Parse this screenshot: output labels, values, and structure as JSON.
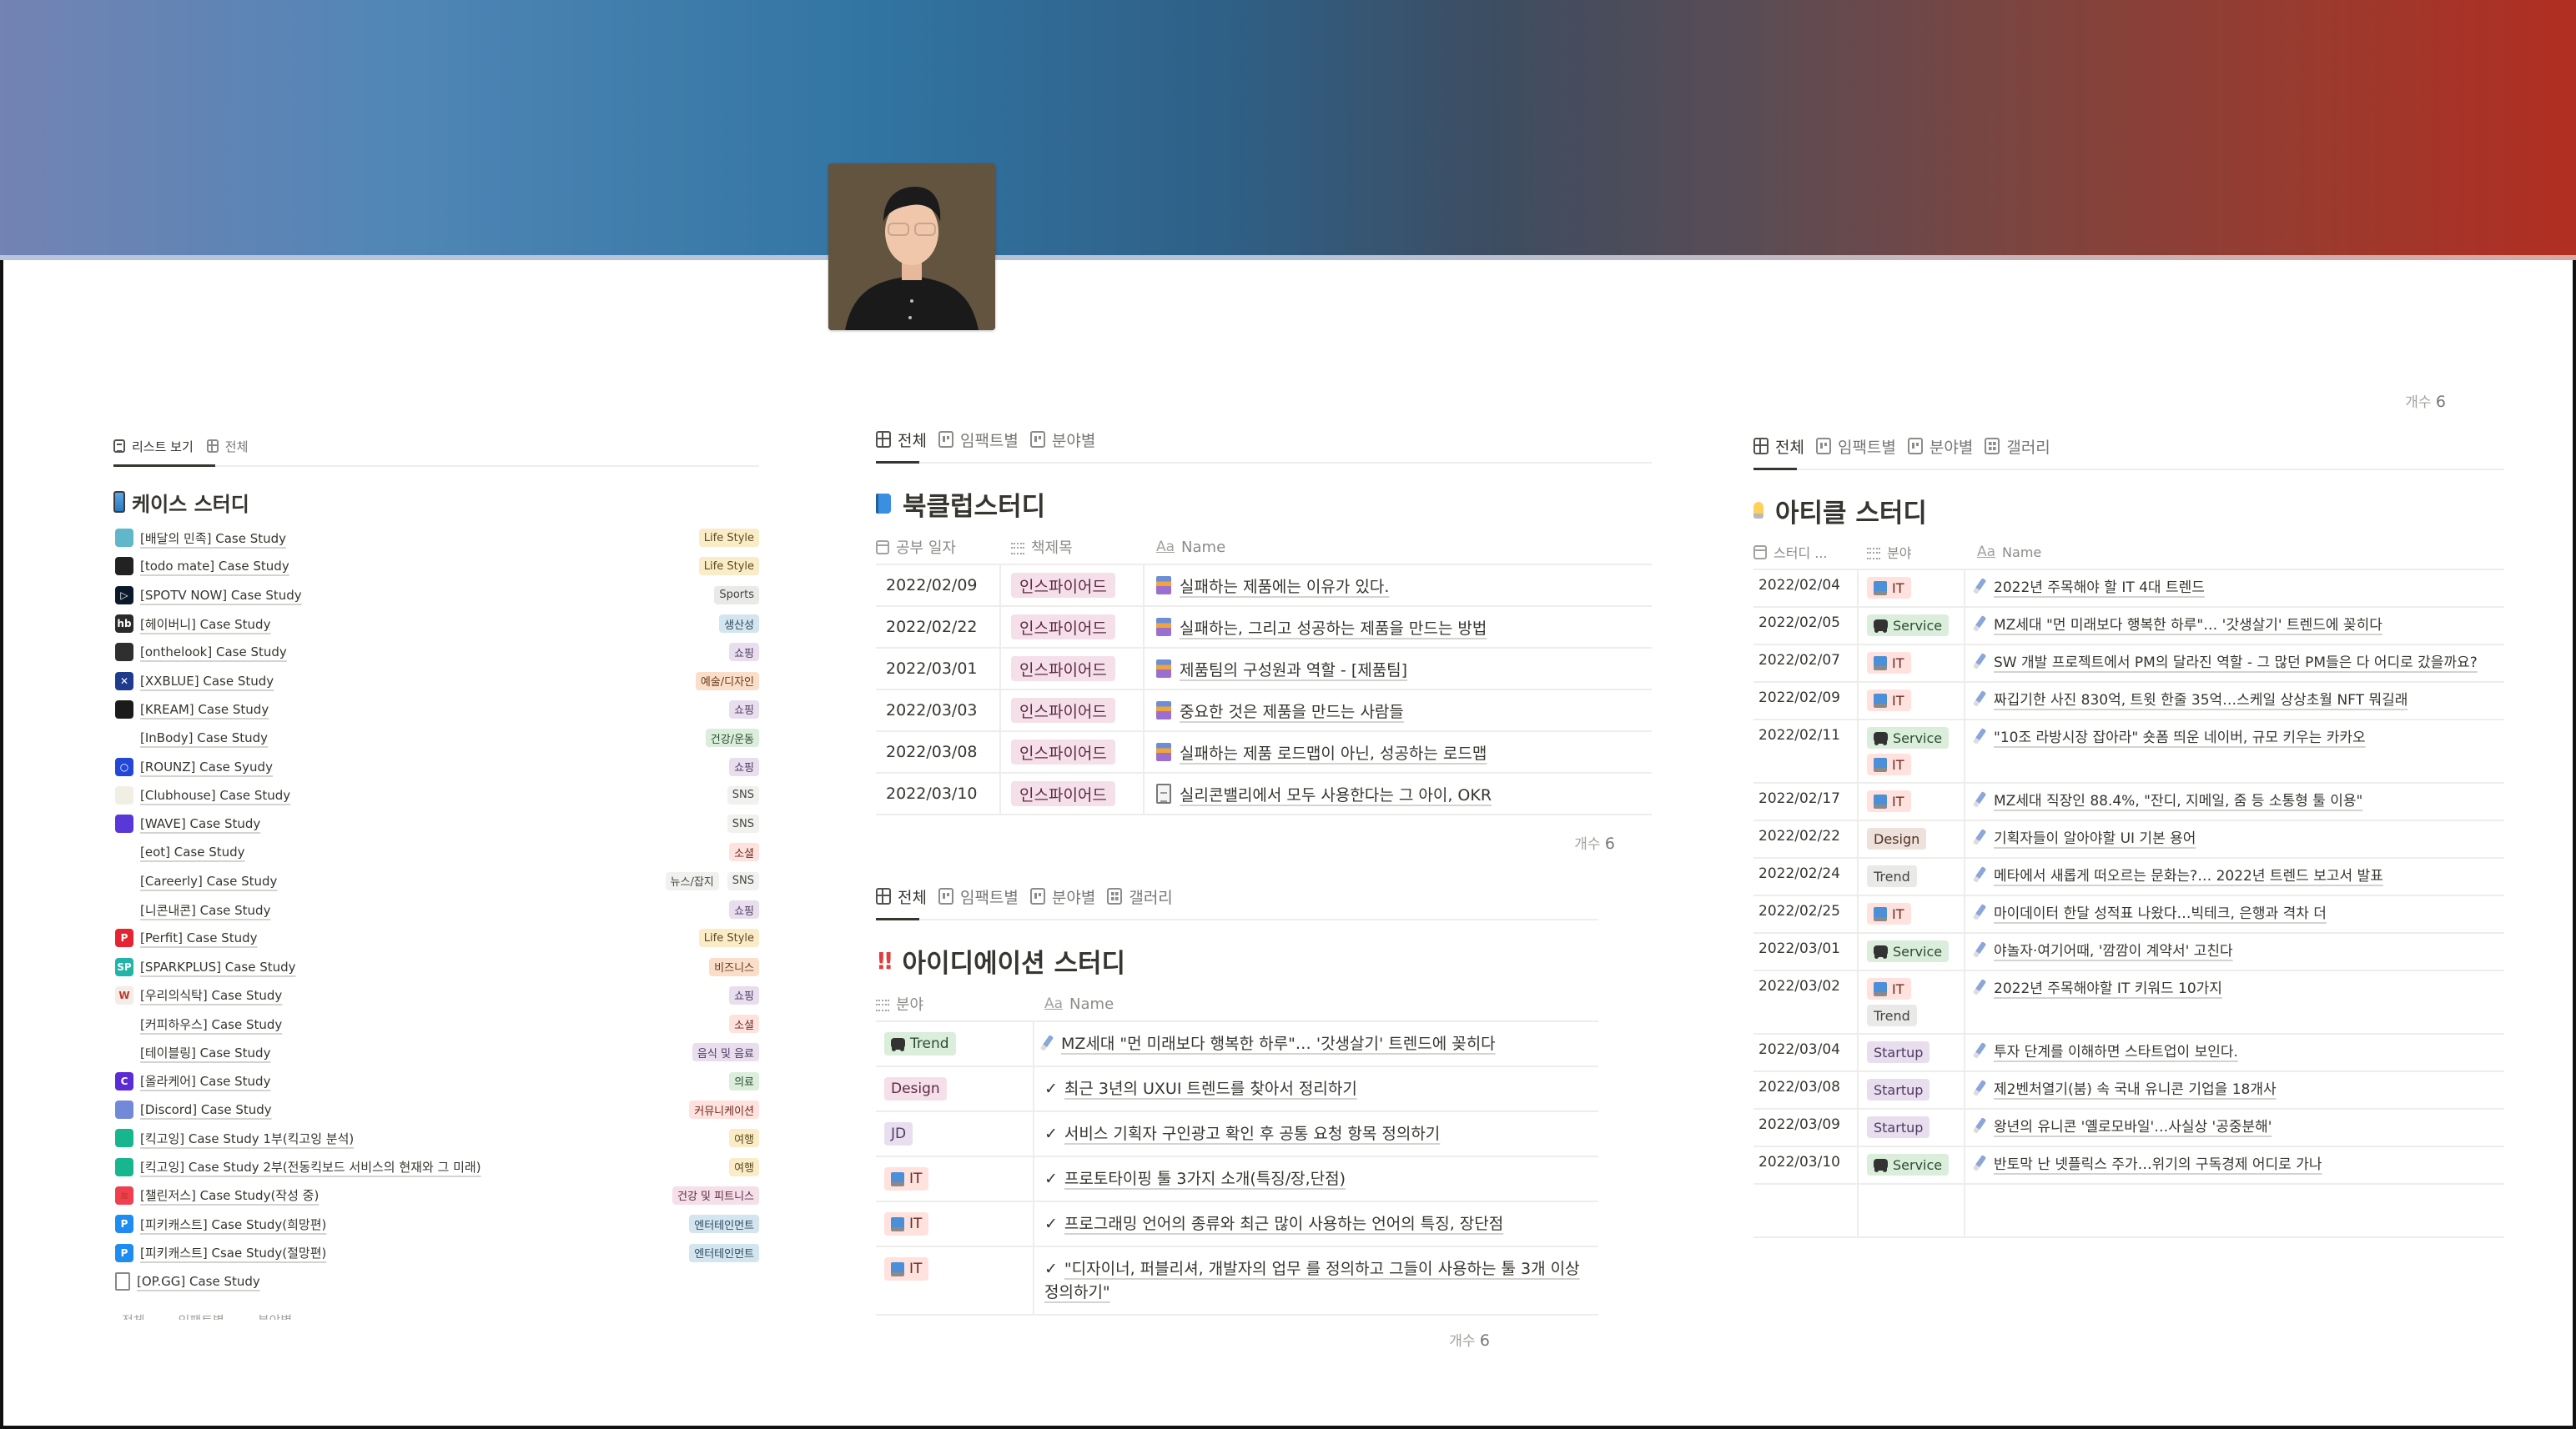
{
  "profile": {
    "avatar_alt": "profile photo"
  },
  "colors": {
    "banner_start": "#7383b3",
    "banner_mid": "#3174a2",
    "banner_end": "#b12e22"
  },
  "case_study": {
    "tabs": [
      {
        "label": "리스트 보기",
        "icon": "list-icon",
        "active": true
      },
      {
        "label": "전체",
        "icon": "table-icon",
        "active": false
      }
    ],
    "title": "케이스 스터디",
    "title_icon": "mobile-phone-icon",
    "items": [
      {
        "name": "[배달의 민족] Case Study",
        "icon_color": "#5fb7c9",
        "icon_text": "",
        "tags": [
          {
            "label": "Life Style",
            "color": "yellow"
          }
        ]
      },
      {
        "name": "[todo mate] Case Study",
        "icon_color": "#222222",
        "icon_text": "",
        "tags": [
          {
            "label": "Life Style",
            "color": "yellow"
          }
        ]
      },
      {
        "name": "[SPOTV NOW] Case Study",
        "icon_color": "#0b1a2a",
        "icon_text": "▷",
        "tags": [
          {
            "label": "Sports",
            "color": "gray"
          }
        ]
      },
      {
        "name": "[헤이버니] Case Study",
        "icon_color": "#2a2a2a",
        "icon_text": "hb",
        "tags": [
          {
            "label": "생산성",
            "color": "blue"
          }
        ]
      },
      {
        "name": "[onthelook] Case Study",
        "icon_color": "#2f2f2f",
        "icon_text": "",
        "tags": [
          {
            "label": "쇼핑",
            "color": "purple"
          }
        ]
      },
      {
        "name": "[XXBLUE] Case Study",
        "icon_color": "#1f3b8c",
        "icon_text": "✕",
        "tags": [
          {
            "label": "예술/디자인",
            "color": "orange"
          }
        ]
      },
      {
        "name": "[KREAM] Case Study",
        "icon_color": "#1b1b1b",
        "icon_text": "",
        "tags": [
          {
            "label": "쇼핑",
            "color": "purple"
          }
        ]
      },
      {
        "name": "[InBody] Case Study",
        "icon_color": "#ffffff",
        "icon_text": "",
        "tags": [
          {
            "label": "건강/운동",
            "color": "green"
          }
        ]
      },
      {
        "name": "[ROUNZ] Case Syudy",
        "icon_color": "#2347d6",
        "icon_text": "○",
        "tags": [
          {
            "label": "쇼핑",
            "color": "purple"
          }
        ]
      },
      {
        "name": "[Clubhouse] Case Study",
        "icon_color": "#f1efe4",
        "icon_text": "",
        "tags": [
          {
            "label": "SNS",
            "color": "lightgray"
          }
        ]
      },
      {
        "name": "[WAVE] Case Study",
        "icon_color": "#5a37d8",
        "icon_text": "",
        "tags": [
          {
            "label": "SNS",
            "color": "lightgray"
          }
        ]
      },
      {
        "name": "[eot] Case Study",
        "icon_color": "#ffffff",
        "icon_text": "",
        "tags": [
          {
            "label": "소셜",
            "color": "red"
          }
        ]
      },
      {
        "name": "[Careerly] Case Study",
        "icon_color": "#ffffff",
        "icon_text": "",
        "tags": [
          {
            "label": "뉴스/잡지",
            "color": "lightgray"
          },
          {
            "label": "SNS",
            "color": "lightgray"
          }
        ]
      },
      {
        "name": "[니콘내콘] Case Study",
        "icon_color": "#ffffff",
        "icon_text": "",
        "tags": [
          {
            "label": "쇼핑",
            "color": "purple"
          }
        ]
      },
      {
        "name": "[Perfit] Case Study",
        "icon_color": "#e52431",
        "icon_text": "P",
        "tags": [
          {
            "label": "Life Style",
            "color": "yellow"
          }
        ]
      },
      {
        "name": "[SPARKPLUS] Case Study",
        "icon_color": "#21b5a8",
        "icon_text": "SP",
        "tags": [
          {
            "label": "비즈니스",
            "color": "orange"
          }
        ]
      },
      {
        "name": "[우리의식탁] Case Study",
        "icon_color": "#f2ede8",
        "icon_text": "W",
        "tags": [
          {
            "label": "쇼핑",
            "color": "purple"
          }
        ]
      },
      {
        "name": "[커피하우스] Case Study",
        "icon_color": "#ffffff",
        "icon_text": "",
        "tags": [
          {
            "label": "소셜",
            "color": "red"
          }
        ]
      },
      {
        "name": "[테이블링] Case Study",
        "icon_color": "#ffffff",
        "icon_text": "",
        "tags": [
          {
            "label": "음식 및 음료",
            "color": "purple"
          }
        ]
      },
      {
        "name": "[올라케어] Case Study",
        "icon_color": "#5b2bd6",
        "icon_text": "C",
        "tags": [
          {
            "label": "의료",
            "color": "green"
          }
        ]
      },
      {
        "name": "[Discord] Case Study",
        "icon_color": "#7289da",
        "icon_text": "",
        "tags": [
          {
            "label": "커뮤니케이션",
            "color": "red"
          }
        ]
      },
      {
        "name": "[킥고잉] Case Study 1부(킥고잉 분석)",
        "icon_color": "#17b68f",
        "icon_text": "",
        "tags": [
          {
            "label": "여행",
            "color": "yellow"
          }
        ]
      },
      {
        "name": "[킥고잉] Case Study 2부(전동킥보드 서비스의 현재와 그 미래)",
        "icon_color": "#17b68f",
        "icon_text": "",
        "tags": [
          {
            "label": "여행",
            "color": "yellow"
          }
        ]
      },
      {
        "name": "[챌린저스] Case Study(작성 중)",
        "icon_color": "#f04050",
        "icon_text": "≋",
        "tags": [
          {
            "label": "건강 및 피트니스",
            "color": "pink"
          }
        ]
      },
      {
        "name": "[피키캐스트] Case Study(희망편)",
        "icon_color": "#1e8cf0",
        "icon_text": "P",
        "tags": [
          {
            "label": "엔터테인먼트",
            "color": "blue"
          }
        ]
      },
      {
        "name": "[피키캐스트] Csae Study(절망편)",
        "icon_color": "#1e8cf0",
        "icon_text": "P",
        "tags": [
          {
            "label": "엔터테인먼트",
            "color": "blue"
          }
        ]
      },
      {
        "name": "[OP.GG] Case Study",
        "icon_color": "none",
        "icon_text": "",
        "tags": []
      }
    ],
    "truncated_tabs": [
      "전체",
      "임팩트별",
      "분야별"
    ]
  },
  "book_club": {
    "tabs": [
      {
        "label": "전체",
        "icon": "table-icon",
        "active": true
      },
      {
        "label": "임팩트별",
        "icon": "board-icon",
        "active": false
      },
      {
        "label": "분야별",
        "icon": "board-icon",
        "active": false
      }
    ],
    "title": "북클럽스터디",
    "title_icon": "blue-book-icon",
    "columns": [
      "공부 일자",
      "책제목",
      "Name"
    ],
    "rows": [
      {
        "date": "2022/02/09",
        "book": "인스파이어드",
        "name": "실패하는 제품에는 이유가 있다.",
        "icon": "books"
      },
      {
        "date": "2022/02/22",
        "book": "인스파이어드",
        "name": "실패하는, 그리고 성공하는 제품을 만드는 방법",
        "icon": "books"
      },
      {
        "date": "2022/03/01",
        "book": "인스파이어드",
        "name": "제품팀의 구성원과 역할 - [제품팀]",
        "icon": "books"
      },
      {
        "date": "2022/03/03",
        "book": "인스파이어드",
        "name": "중요한 것은 제품을 만드는 사람들",
        "icon": "books"
      },
      {
        "date": "2022/03/08",
        "book": "인스파이어드",
        "name": "실패하는 제품 로드맵이 아닌, 성공하는 로드맵",
        "icon": "books"
      },
      {
        "date": "2022/03/10",
        "book": "인스파이어드",
        "name": "실리콘밸리에서 모두 사용한다는 그 아이, OKR",
        "icon": "doc"
      }
    ],
    "count_label": "개수",
    "count": "6"
  },
  "ideation": {
    "tabs": [
      {
        "label": "전체",
        "icon": "table-icon",
        "active": true
      },
      {
        "label": "임팩트별",
        "icon": "board-icon",
        "active": false
      },
      {
        "label": "분야별",
        "icon": "board-icon",
        "active": false
      },
      {
        "label": "갤러리",
        "icon": "gallery-icon",
        "active": false
      }
    ],
    "title": "아이디에이션 스터디",
    "title_icon": "double-exclamation-icon",
    "columns": [
      "분야",
      "Name"
    ],
    "rows": [
      {
        "field": "Trend",
        "field_color": "green",
        "field_icon": "gamepad",
        "name": "MZ세대 \"먼 미래보다 행복한 하루\"… '갓생살기' 트렌드에 꽂히다",
        "icon": "pencil"
      },
      {
        "field": "Design",
        "field_color": "pink",
        "field_icon": "",
        "name": "최근 3년의 UXUI 트렌드를 찾아서 정리하기",
        "icon": "check"
      },
      {
        "field": "JD",
        "field_color": "purple",
        "field_icon": "",
        "name": "서비스 기획자 구인광고 확인 후 공통 요청 항목 정의하기",
        "icon": "check"
      },
      {
        "field": "IT",
        "field_color": "red",
        "field_icon": "laptop",
        "name": "프로토타이핑 툴 3가지 소개(특징/장,단점)",
        "icon": "check"
      },
      {
        "field": "IT",
        "field_color": "red",
        "field_icon": "laptop",
        "name": "프로그래밍 언어의 종류와 최근 많이 사용하는 언어의 특징, 장단점",
        "icon": "check"
      },
      {
        "field": "IT",
        "field_color": "red",
        "field_icon": "laptop",
        "name": "\"디자이너, 퍼블리셔, 개발자의 업무 를 정의하고 그들이 사용하는 툴 3개 이상 정의하기\"",
        "icon": "check"
      }
    ],
    "count_label": "개수",
    "count": "6"
  },
  "article": {
    "top_count_label": "개수",
    "top_count": "6",
    "tabs": [
      {
        "label": "전체",
        "icon": "table-icon",
        "active": true
      },
      {
        "label": "임팩트별",
        "icon": "board-icon",
        "active": false
      },
      {
        "label": "분야별",
        "icon": "board-icon",
        "active": false
      },
      {
        "label": "갤러리",
        "icon": "gallery-icon",
        "active": false
      }
    ],
    "title": "아티클 스터디",
    "title_icon": "light-bulb-icon",
    "columns": [
      "스터디 ...",
      "분야",
      "Name"
    ],
    "rows": [
      {
        "date": "2022/02/04",
        "fields": [
          {
            "label": "IT",
            "color": "red",
            "icon": "laptop"
          }
        ],
        "name": "2022년 주목해야 할 IT 4대 트렌드"
      },
      {
        "date": "2022/02/05",
        "fields": [
          {
            "label": "Service",
            "color": "green",
            "icon": "gamepad"
          }
        ],
        "name": "MZ세대 \"먼 미래보다 행복한 하루\"… '갓생살기' 트렌드에 꽂히다"
      },
      {
        "date": "2022/02/07",
        "fields": [
          {
            "label": "IT",
            "color": "red",
            "icon": "laptop"
          }
        ],
        "name": "SW 개발 프로젝트에서 PM의 달라진 역할 - 그 많던 PM들은 다 어디로 갔을까요?"
      },
      {
        "date": "2022/02/09",
        "fields": [
          {
            "label": "IT",
            "color": "red",
            "icon": "laptop"
          }
        ],
        "name": "짜깁기한 사진 830억, 트윗 한줄 35억…스케일 상상초월 NFT 뭐길래"
      },
      {
        "date": "2022/02/11",
        "fields": [
          {
            "label": "Service",
            "color": "green",
            "icon": "gamepad"
          },
          {
            "label": "IT",
            "color": "red",
            "icon": "laptop"
          }
        ],
        "name": "\"10조 라방시장 잡아라\" 숏폼 띄운 네이버, 규모 키우는 카카오"
      },
      {
        "date": "2022/02/17",
        "fields": [
          {
            "label": "IT",
            "color": "red",
            "icon": "laptop"
          }
        ],
        "name": "MZ세대 직장인 88.4%, \"잔디, 지메일, 줌 등 소통형 툴 이용\""
      },
      {
        "date": "2022/02/22",
        "fields": [
          {
            "label": "Design",
            "color": "brown",
            "icon": ""
          }
        ],
        "name": "기획자들이 알아야할 UI 기본 용어"
      },
      {
        "date": "2022/02/24",
        "fields": [
          {
            "label": "Trend",
            "color": "gray",
            "icon": ""
          }
        ],
        "name": "메타에서 새롭게 떠오르는 문화는?… 2022년 트렌드 보고서 발표"
      },
      {
        "date": "2022/02/25",
        "fields": [
          {
            "label": "IT",
            "color": "red",
            "icon": "laptop"
          }
        ],
        "name": "마이데이터 한달 성적표 나왔다…빅테크, 은행과 격차 더"
      },
      {
        "date": "2022/03/01",
        "fields": [
          {
            "label": "Service",
            "color": "green",
            "icon": "gamepad"
          }
        ],
        "name": "야놀자·여기어때, '깜깜이 계약서' 고친다"
      },
      {
        "date": "2022/03/02",
        "fields": [
          {
            "label": "IT",
            "color": "red",
            "icon": "laptop"
          },
          {
            "label": "Trend",
            "color": "gray",
            "icon": ""
          }
        ],
        "name": "2022년 주목해야할 IT 키워드 10가지"
      },
      {
        "date": "2022/03/04",
        "fields": [
          {
            "label": "Startup",
            "color": "purple",
            "icon": ""
          }
        ],
        "name": "투자 단계를 이해하면 스타트업이 보인다."
      },
      {
        "date": "2022/03/08",
        "fields": [
          {
            "label": "Startup",
            "color": "purple",
            "icon": ""
          }
        ],
        "name": "제2벤처열기(붐) 속 국내 유니콘 기업을 18개사"
      },
      {
        "date": "2022/03/09",
        "fields": [
          {
            "label": "Startup",
            "color": "purple",
            "icon": ""
          }
        ],
        "name": "왕년의 유니콘 '옐로모바일'…사실상 '공중분해'"
      },
      {
        "date": "2022/03/10",
        "fields": [
          {
            "label": "Service",
            "color": "green",
            "icon": "gamepad"
          }
        ],
        "name": "반토막 난 넷플릭스 주가…위기의 구독경제 어디로 가나"
      }
    ]
  }
}
